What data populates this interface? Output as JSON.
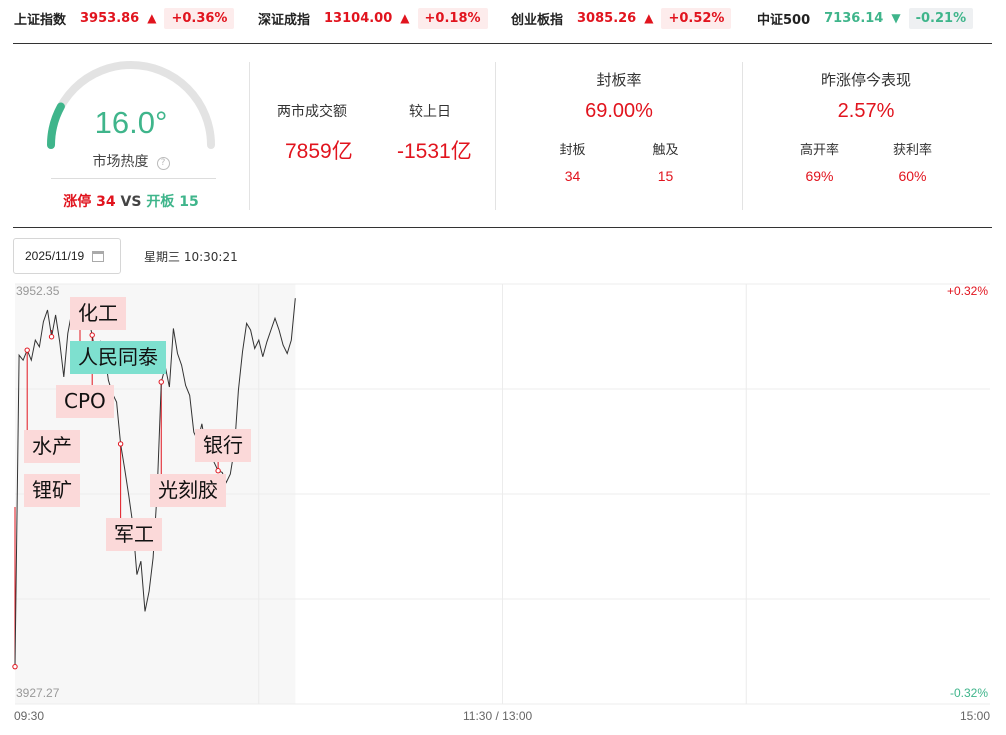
{
  "indices": [
    {
      "name": "上证指数",
      "value": "3953.86",
      "arrow": "▲",
      "change": "+0.36%",
      "dir": "up"
    },
    {
      "name": "深证成指",
      "value": "13104.00",
      "arrow": "▲",
      "change": "+0.18%",
      "dir": "up"
    },
    {
      "name": "创业板指",
      "value": "3085.26",
      "arrow": "▲",
      "change": "+0.52%",
      "dir": "up"
    },
    {
      "name": "中证500",
      "value": "7136.14",
      "arrow": "▼",
      "change": "-0.21%",
      "dir": "down"
    }
  ],
  "heat": {
    "temperature": "16.0°",
    "level": 0.16,
    "label": "市场热度",
    "help": "?",
    "limit_up_label": "涨停",
    "limit_up_count": "34",
    "vs": "VS",
    "broken_label": "开板",
    "broken_count": "15"
  },
  "turnover": {
    "amount_label": "两市成交额",
    "amount": "7859亿",
    "delta_label": "较上日",
    "delta": "-1531亿"
  },
  "seal_rate": {
    "title": "封板率",
    "value": "69.00%",
    "subs": [
      {
        "label": "封板",
        "value": "34"
      },
      {
        "label": "触及",
        "value": "15"
      }
    ]
  },
  "yesterday": {
    "title": "昨涨停今表现",
    "value": "2.57%",
    "subs": [
      {
        "label": "高开率",
        "value": "69%"
      },
      {
        "label": "获利率",
        "value": "60%"
      }
    ]
  },
  "date": "2025/11/19",
  "weekday_time": "星期三 10:30:21",
  "colors": {
    "up": "#e1141e",
    "down": "#3fb58b",
    "tag": "#fbd9d9",
    "tag_highlight": "#7ee0cf"
  },
  "chart_data": {
    "type": "line",
    "y_max": "3952.35",
    "y_min": "3927.27",
    "pct_max": "+0.32%",
    "pct_min": "-0.32%",
    "x_ticks": [
      "09:30",
      "11:30 / 13:00",
      "15:00"
    ],
    "values": [
      3929.5,
      3948.1,
      3947.8,
      3948.4,
      3947.8,
      3949.0,
      3948.6,
      3950.1,
      3950.8,
      3949.2,
      3950.5,
      3948.9,
      3946.8,
      3949.4,
      3950.7,
      3949.7,
      3951.0,
      3949.9,
      3950.4,
      3949.3,
      3947.8,
      3948.9,
      3948.3,
      3946.6,
      3945.8,
      3945.3,
      3942.8,
      3941.3,
      3939.7,
      3938.0,
      3935.0,
      3935.8,
      3932.8,
      3934.0,
      3936.0,
      3940.0,
      3946.5,
      3947.4,
      3946.2,
      3949.7,
      3948.2,
      3947.5,
      3946.3,
      3945.7,
      3943.5,
      3943.0,
      3944.0,
      3942.5,
      3942.3,
      3941.7,
      3941.2,
      3941.1,
      3940.5,
      3941.0,
      3942.5,
      3946.0,
      3948.3,
      3950.0,
      3949.6,
      3948.5,
      3949.0,
      3948.0,
      3948.9,
      3949.6,
      3950.3,
      3949.6,
      3948.7,
      3948.2,
      3949.0,
      3951.5
    ],
    "events": [
      {
        "label": "锂矿",
        "index": 0,
        "style": "pink"
      },
      {
        "label": "水产",
        "index": 3,
        "style": "pink"
      },
      {
        "label": "化工",
        "index": 9,
        "style": "pink"
      },
      {
        "label": "人民同泰",
        "index": 16,
        "style": "cyan"
      },
      {
        "label": "CPO",
        "index": 19,
        "style": "pink"
      },
      {
        "label": "军工",
        "index": 26,
        "style": "pink"
      },
      {
        "label": "光刻胶",
        "index": 36,
        "style": "pink"
      },
      {
        "label": "银行",
        "index": 50,
        "style": "pink"
      }
    ]
  }
}
